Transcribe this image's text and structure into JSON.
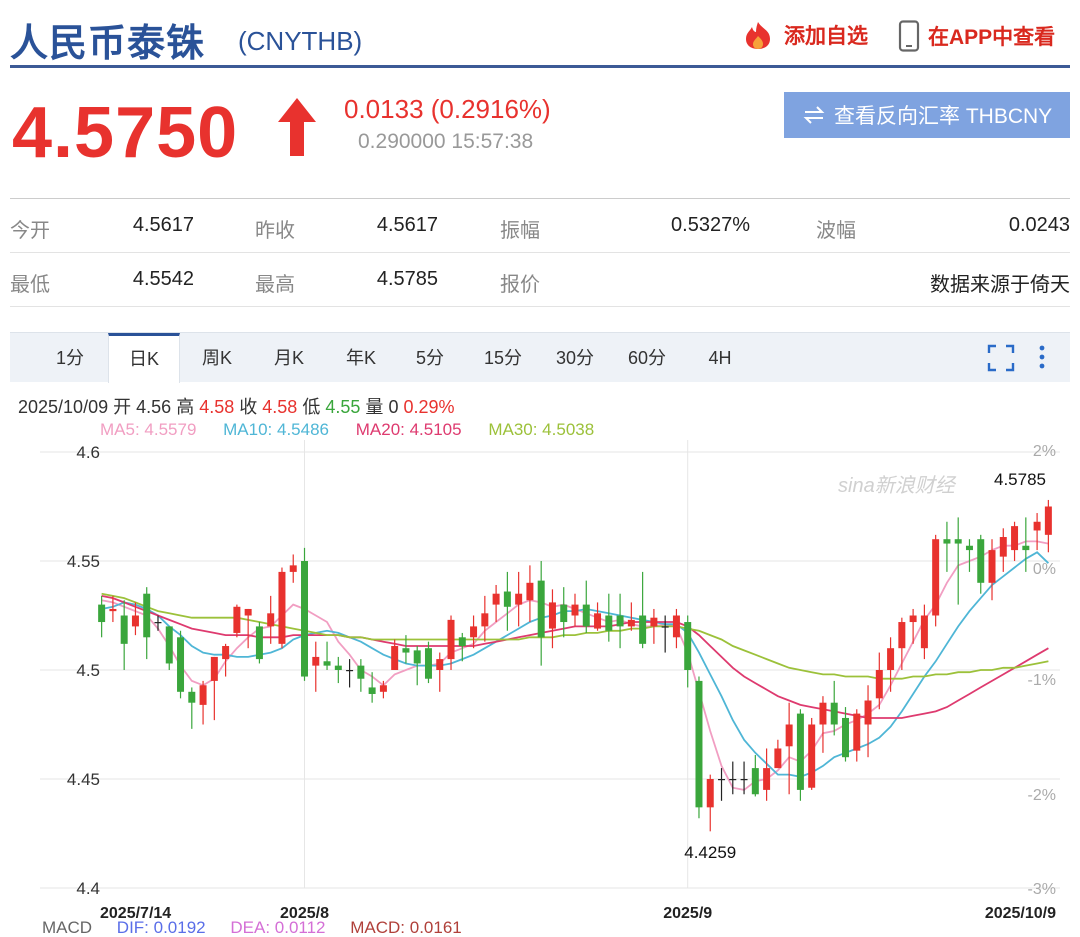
{
  "header": {
    "name": "人民币泰铢",
    "code": "(CNYTHB)",
    "add_watch": "添加自选",
    "view_app": "在APP中查看"
  },
  "quote": {
    "price": "4.5750",
    "change": "0.0133 (0.2916%)",
    "sub": "0.290000 15:57:38",
    "reverse_btn": "查看反向汇率 THBCNY"
  },
  "stats": {
    "row1": [
      {
        "label": "今开",
        "value": "4.5617"
      },
      {
        "label": "昨收",
        "value": "4.5617"
      },
      {
        "label": "振幅",
        "value": "0.5327%"
      },
      {
        "label": "波幅",
        "value": "0.0243"
      }
    ],
    "row2": [
      {
        "label": "最低",
        "value": "4.5542"
      },
      {
        "label": "最高",
        "value": "4.5785"
      },
      {
        "label": "报价",
        "value": ""
      },
      {
        "label": "",
        "value": "数据来源于倚天"
      }
    ]
  },
  "tabs": [
    "1分",
    "日K",
    "周K",
    "月K",
    "年K",
    "5分",
    "15分",
    "30分",
    "60分",
    "4H"
  ],
  "active_tab": "日K",
  "info": {
    "date": "2025/10/09",
    "open_label": "开",
    "open": "4.56",
    "high_label": "高",
    "high": "4.58",
    "close_label": "收",
    "close": "4.58",
    "low_label": "低",
    "low": "4.55",
    "vol_label": "量",
    "vol": "0",
    "pct": "0.29%"
  },
  "ma": [
    {
      "label": "MA5: 4.5579",
      "color": "#f19ec2"
    },
    {
      "label": "MA10: 4.5486",
      "color": "#4fb6d6"
    },
    {
      "label": "MA20: 4.5105",
      "color": "#de3a6f"
    },
    {
      "label": "MA30: 4.5038",
      "color": "#9cc13a"
    }
  ],
  "macd": {
    "label": "MACD",
    "dif": "DIF: 0.0192",
    "dea": "DEA: 0.0112",
    "macd": "MACD: 0.0161"
  },
  "watermark": "sina新浪财经",
  "colors": {
    "up": "#e8322e",
    "down": "#3aa63c",
    "brand": "#2a5298"
  },
  "chart_data": {
    "type": "candlestick",
    "y_ticks": [
      "4.6",
      "4.55",
      "4.5",
      "4.45",
      "4.4"
    ],
    "right_ticks": [
      "2%",
      "0%",
      "-1%",
      "-2%",
      "-3%"
    ],
    "x_ticks": [
      "2025/7/14",
      "2025/8",
      "2025/9",
      "2025/10/9"
    ],
    "ylim": [
      4.4,
      4.6
    ],
    "annotations": [
      {
        "label": "4.5785",
        "value": 4.5785
      },
      {
        "label": "4.4259",
        "value": 4.4259
      }
    ],
    "candles": [
      [
        4.53,
        4.522,
        4.534,
        4.515
      ],
      [
        4.527,
        4.528,
        4.534,
        4.522
      ],
      [
        4.525,
        4.512,
        4.532,
        4.5
      ],
      [
        4.52,
        4.525,
        4.531,
        4.516
      ],
      [
        4.535,
        4.515,
        4.538,
        4.505
      ],
      [
        4.522,
        4.522,
        4.525,
        4.518
      ],
      [
        4.52,
        4.503,
        4.52,
        4.5
      ],
      [
        4.515,
        4.49,
        4.518,
        4.487
      ],
      [
        4.49,
        4.485,
        4.492,
        4.473
      ],
      [
        4.484,
        4.493,
        4.495,
        4.475
      ],
      [
        4.495,
        4.506,
        4.506,
        4.477
      ],
      [
        4.505,
        4.511,
        4.512,
        4.497
      ],
      [
        4.517,
        4.529,
        4.53,
        4.515
      ],
      [
        4.525,
        4.528,
        4.528,
        4.51
      ],
      [
        4.52,
        4.505,
        4.522,
        4.503
      ],
      [
        4.52,
        4.526,
        4.534,
        4.512
      ],
      [
        4.512,
        4.545,
        4.547,
        4.51
      ],
      [
        4.545,
        4.548,
        4.553,
        4.54
      ],
      [
        4.55,
        4.497,
        4.556,
        4.495
      ],
      [
        4.502,
        4.506,
        4.513,
        4.49
      ],
      [
        4.504,
        4.502,
        4.513,
        4.5
      ],
      [
        4.502,
        4.5,
        4.506,
        4.494
      ],
      [
        4.5,
        4.5,
        4.505,
        4.492
      ],
      [
        4.502,
        4.496,
        4.505,
        4.49
      ],
      [
        4.492,
        4.489,
        4.499,
        4.485
      ],
      [
        4.49,
        4.493,
        4.495,
        4.487
      ],
      [
        4.5,
        4.511,
        4.514,
        4.5
      ],
      [
        4.51,
        4.508,
        4.516,
        4.503
      ],
      [
        4.509,
        4.503,
        4.511,
        4.493
      ],
      [
        4.51,
        4.496,
        4.513,
        4.494
      ],
      [
        4.5,
        4.505,
        4.508,
        4.49
      ],
      [
        4.505,
        4.523,
        4.525,
        4.5
      ],
      [
        4.515,
        4.511,
        4.517,
        4.504
      ],
      [
        4.515,
        4.52,
        4.525,
        4.51
      ],
      [
        4.52,
        4.526,
        4.534,
        4.513
      ],
      [
        4.53,
        4.535,
        4.539,
        4.522
      ],
      [
        4.536,
        4.529,
        4.545,
        4.518
      ],
      [
        4.53,
        4.535,
        4.545,
        4.52
      ],
      [
        4.532,
        4.54,
        4.548,
        4.522
      ],
      [
        4.541,
        4.515,
        4.55,
        4.502
      ],
      [
        4.519,
        4.531,
        4.537,
        4.51
      ],
      [
        4.53,
        4.522,
        4.538,
        4.515
      ],
      [
        4.525,
        4.53,
        4.535,
        4.52
      ],
      [
        4.53,
        4.52,
        4.541,
        4.517
      ],
      [
        4.519,
        4.526,
        4.531,
        4.518
      ],
      [
        4.525,
        4.518,
        4.535,
        4.513
      ],
      [
        4.525,
        4.52,
        4.535,
        4.51
      ],
      [
        4.52,
        4.523,
        4.531,
        4.518
      ],
      [
        4.525,
        4.512,
        4.545,
        4.51
      ],
      [
        4.52,
        4.524,
        4.528,
        4.512
      ],
      [
        4.52,
        4.52,
        4.525,
        4.508
      ],
      [
        4.515,
        4.525,
        4.528,
        4.51
      ],
      [
        4.522,
        4.5,
        4.525,
        4.492
      ],
      [
        4.495,
        4.437,
        4.497,
        4.432
      ],
      [
        4.437,
        4.45,
        4.452,
        4.426
      ],
      [
        4.45,
        4.45,
        4.455,
        4.44
      ],
      [
        4.45,
        4.45,
        4.458,
        4.443
      ],
      [
        4.45,
        4.45,
        4.458,
        4.443
      ],
      [
        4.455,
        4.443,
        4.461,
        4.442
      ],
      [
        4.445,
        4.455,
        4.464,
        4.44
      ],
      [
        4.455,
        4.464,
        4.468,
        4.455
      ],
      [
        4.465,
        4.475,
        4.485,
        4.443
      ],
      [
        4.48,
        4.445,
        4.482,
        4.44
      ],
      [
        4.446,
        4.475,
        4.478,
        4.445
      ],
      [
        4.475,
        4.485,
        4.488,
        4.462
      ],
      [
        4.485,
        4.475,
        4.495,
        4.47
      ],
      [
        4.478,
        4.46,
        4.483,
        4.458
      ],
      [
        4.463,
        4.48,
        4.482,
        4.458
      ],
      [
        4.475,
        4.486,
        4.493,
        4.46
      ],
      [
        4.487,
        4.5,
        4.508,
        4.482
      ],
      [
        4.5,
        4.51,
        4.515,
        4.49
      ],
      [
        4.51,
        4.522,
        4.524,
        4.5
      ],
      [
        4.522,
        4.525,
        4.528,
        4.512
      ],
      [
        4.51,
        4.525,
        4.53,
        4.505
      ],
      [
        4.525,
        4.56,
        4.562,
        4.52
      ],
      [
        4.56,
        4.558,
        4.568,
        4.545
      ],
      [
        4.56,
        4.558,
        4.57,
        4.53
      ],
      [
        4.557,
        4.555,
        4.56,
        4.545
      ],
      [
        4.56,
        4.54,
        4.562,
        4.535
      ],
      [
        4.54,
        4.555,
        4.56,
        4.532
      ],
      [
        4.552,
        4.561,
        4.565,
        4.545
      ],
      [
        4.555,
        4.566,
        4.568,
        4.55
      ],
      [
        4.557,
        4.555,
        4.57,
        4.545
      ],
      [
        4.564,
        4.568,
        4.572,
        4.555
      ],
      [
        4.562,
        4.575,
        4.578,
        4.554
      ]
    ],
    "ma5": [
      4.532,
      4.531,
      4.529,
      4.527,
      4.525,
      4.519,
      4.511,
      4.502,
      4.495,
      4.493,
      4.496,
      4.504,
      4.51,
      4.515,
      4.519,
      4.52,
      4.525,
      4.53,
      4.528,
      4.525,
      4.522,
      4.513,
      4.507,
      4.5,
      4.497,
      4.493,
      4.498,
      4.5,
      4.502,
      4.502,
      4.503,
      4.508,
      4.51,
      4.512,
      4.518,
      4.522,
      4.526,
      4.53,
      4.532,
      4.531,
      4.529,
      4.53,
      4.528,
      4.526,
      4.524,
      4.522,
      4.523,
      4.521,
      4.52,
      4.52,
      4.521,
      4.52,
      4.508,
      4.49,
      4.472,
      4.456,
      4.446,
      4.445,
      4.449,
      4.45,
      4.454,
      4.46,
      4.458,
      4.463,
      4.471,
      4.472,
      4.475,
      4.477,
      4.48,
      4.484,
      4.493,
      4.503,
      4.513,
      4.523,
      4.53,
      4.54,
      4.548,
      4.55,
      4.552,
      4.555,
      4.557,
      4.557,
      4.559,
      4.559,
      4.558
    ],
    "ma10": [
      4.528,
      4.529,
      4.531,
      4.53,
      4.528,
      4.525,
      4.52,
      4.516,
      4.511,
      4.508,
      4.507,
      4.507,
      4.506,
      4.506,
      4.507,
      4.508,
      4.51,
      4.514,
      4.516,
      4.517,
      4.518,
      4.517,
      4.515,
      4.513,
      4.51,
      4.507,
      4.505,
      4.503,
      4.502,
      4.502,
      4.502,
      4.503,
      4.505,
      4.507,
      4.51,
      4.513,
      4.516,
      4.519,
      4.522,
      4.524,
      4.525,
      4.527,
      4.527,
      4.528,
      4.527,
      4.526,
      4.525,
      4.524,
      4.523,
      4.522,
      4.521,
      4.521,
      4.517,
      4.508,
      4.498,
      4.488,
      4.477,
      4.468,
      4.462,
      4.457,
      4.452,
      4.452,
      4.451,
      4.453,
      4.456,
      4.46,
      4.462,
      4.464,
      4.466,
      4.469,
      4.474,
      4.481,
      4.489,
      4.497,
      4.504,
      4.512,
      4.52,
      4.527,
      4.533,
      4.539,
      4.543,
      4.547,
      4.551,
      4.554,
      4.549
    ],
    "ma20": [
      4.534,
      4.533,
      4.531,
      4.529,
      4.527,
      4.525,
      4.523,
      4.521,
      4.519,
      4.518,
      4.517,
      4.516,
      4.516,
      4.516,
      4.515,
      4.515,
      4.515,
      4.516,
      4.516,
      4.516,
      4.516,
      4.516,
      4.515,
      4.515,
      4.514,
      4.513,
      4.512,
      4.511,
      4.511,
      4.511,
      4.511,
      4.511,
      4.511,
      4.511,
      4.512,
      4.513,
      4.514,
      4.515,
      4.516,
      4.517,
      4.518,
      4.519,
      4.52,
      4.52,
      4.52,
      4.52,
      4.521,
      4.522,
      4.522,
      4.522,
      4.522,
      4.522,
      4.52,
      4.516,
      4.511,
      4.506,
      4.501,
      4.497,
      4.494,
      4.491,
      4.488,
      4.486,
      4.484,
      4.483,
      4.482,
      4.481,
      4.48,
      4.479,
      4.478,
      4.478,
      4.478,
      4.478,
      4.479,
      4.48,
      4.481,
      4.483,
      4.486,
      4.489,
      4.492,
      4.495,
      4.498,
      4.501,
      4.504,
      4.507,
      4.51
    ],
    "ma30": [
      4.535,
      4.534,
      4.533,
      4.531,
      4.529,
      4.527,
      4.526,
      4.525,
      4.524,
      4.524,
      4.524,
      4.524,
      4.524,
      4.523,
      4.522,
      4.521,
      4.52,
      4.519,
      4.518,
      4.517,
      4.516,
      4.516,
      4.515,
      4.515,
      4.514,
      4.514,
      4.514,
      4.514,
      4.514,
      4.514,
      4.514,
      4.514,
      4.514,
      4.514,
      4.514,
      4.514,
      4.514,
      4.514,
      4.515,
      4.515,
      4.515,
      4.516,
      4.516,
      4.517,
      4.517,
      4.518,
      4.518,
      4.519,
      4.519,
      4.52,
      4.52,
      4.52,
      4.519,
      4.518,
      4.516,
      4.514,
      4.511,
      4.509,
      4.507,
      4.505,
      4.503,
      4.501,
      4.5,
      4.499,
      4.498,
      4.498,
      4.497,
      4.497,
      4.497,
      4.496,
      4.496,
      4.496,
      4.497,
      4.497,
      4.498,
      4.498,
      4.499,
      4.499,
      4.5,
      4.5,
      4.501,
      4.501,
      4.502,
      4.503,
      4.504
    ]
  }
}
